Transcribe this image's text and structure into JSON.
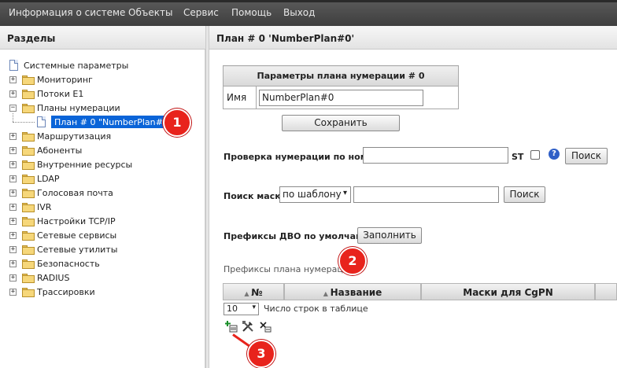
{
  "menubar": {
    "items": [
      "Информация о системе",
      "Объекты",
      "Сервис",
      "Помощь",
      "Выход"
    ]
  },
  "sidebar": {
    "title": "Разделы",
    "root": "Системные параметры",
    "items": [
      {
        "label": "Мониторинг",
        "expanded": false
      },
      {
        "label": "Потоки E1",
        "expanded": false
      },
      {
        "label": "Планы нумерации",
        "expanded": true
      },
      {
        "label": "Маршрутизация",
        "expanded": false
      },
      {
        "label": "Абоненты",
        "expanded": false
      },
      {
        "label": "Внутренние ресурсы",
        "expanded": false
      },
      {
        "label": "LDAP",
        "expanded": false
      },
      {
        "label": "Голосовая почта",
        "expanded": false
      },
      {
        "label": "IVR",
        "expanded": false
      },
      {
        "label": "Настройки TCP/IP",
        "expanded": false
      },
      {
        "label": "Сетевые сервисы",
        "expanded": false
      },
      {
        "label": "Сетевые утилиты",
        "expanded": false
      },
      {
        "label": "Безопасность",
        "expanded": false
      },
      {
        "label": "RADIUS",
        "expanded": false
      },
      {
        "label": "Трассировки",
        "expanded": false
      }
    ],
    "selected_child": "План # 0 \"NumberPlan#0\""
  },
  "main": {
    "title": "План # 0 'NumberPlan#0'",
    "params_table": {
      "header": "Параметры плана нумерации # 0",
      "name_label": "Имя",
      "name_value": "NumberPlan#0"
    },
    "save_label": "Сохранить",
    "check_label": "Проверка нумерации по номеру",
    "st_label": "ST",
    "help_glyph": "?",
    "search_label": "Поиск",
    "mask_search_label": "Поиск маски",
    "mask_mode": "по шаблону",
    "search2_label": "Поиск",
    "dvo_label": "Префиксы ДВО по умолчанию",
    "fill_label": "Заполнить",
    "prefixes_title": "Префиксы плана нумерации",
    "grid": {
      "columns": [
        "№",
        "Название",
        "Маски для CgPN"
      ],
      "rows_per_page": "10",
      "rows_label": "Число строк в таблице"
    }
  },
  "annotations": [
    "1",
    "2",
    "3"
  ],
  "colors": {
    "accent_selection": "#0a64d8",
    "callout": "#e8231c",
    "menubar": "#4a4a4a"
  }
}
